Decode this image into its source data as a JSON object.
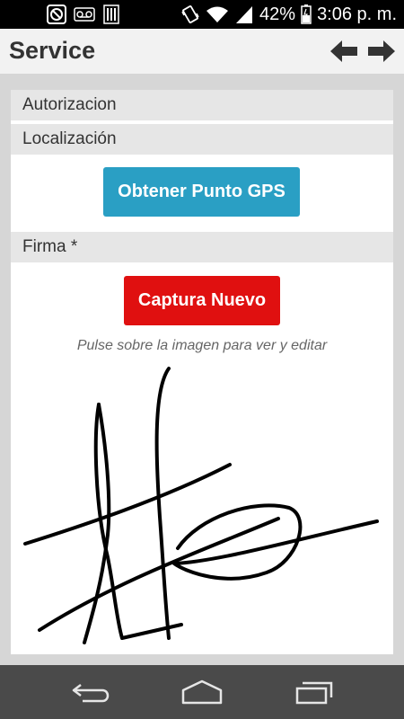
{
  "status_bar": {
    "battery": "42%",
    "time": "3:06 p. m."
  },
  "action_bar": {
    "title": "Service"
  },
  "form": {
    "sections": [
      {
        "label": "Autorizacion"
      },
      {
        "label": "Localización"
      },
      {
        "label": "Firma *"
      }
    ],
    "gps_button_label": "Obtener Punto GPS",
    "capture_button_label": "Captura Nuevo",
    "signature_hint": "Pulse sobre la imagen para ver y editar"
  },
  "colors": {
    "gps_button": "#2a9fc4",
    "capture_button": "#e01010",
    "section_header": "#e6e6e6",
    "nav_bar": "#4a4a4a"
  },
  "icons": {
    "status_left": [
      "blocked-icon",
      "voicemail-icon",
      "barcode-icon"
    ],
    "status_right": [
      "vibrate-icon",
      "wifi-icon",
      "signal-icon",
      "battery-icon"
    ],
    "action": [
      "back-arrow-icon",
      "forward-arrow-icon"
    ],
    "navigation": [
      "back-nav-icon",
      "home-nav-icon",
      "recent-apps-icon"
    ]
  }
}
